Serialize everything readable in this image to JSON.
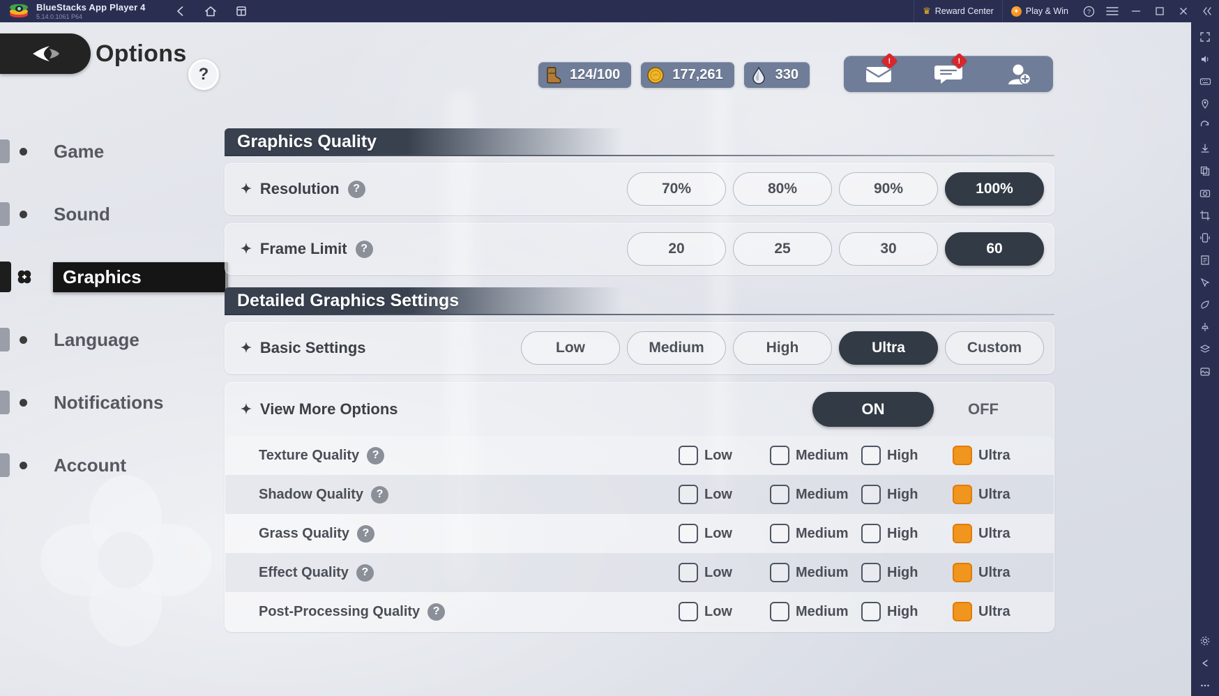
{
  "window": {
    "app_name": "BlueStacks App Player 4",
    "version": "5.14.0.1061  P64",
    "logo_icon": "bluestacks-logo-icon",
    "nav": [
      {
        "name": "back",
        "icon": "arrow-left-icon"
      },
      {
        "name": "home",
        "icon": "home-icon"
      },
      {
        "name": "instances",
        "icon": "multi-instance-icon"
      }
    ],
    "right_items": [
      {
        "label": "Reward Center",
        "icon": "crown-icon"
      },
      {
        "label": "Play & Win",
        "icon": "star-badge-icon"
      }
    ],
    "controls": [
      {
        "name": "help",
        "icon": "help-circle-icon"
      },
      {
        "name": "menu",
        "icon": "hamburger-icon"
      },
      {
        "name": "minimize",
        "icon": "minimize-icon"
      },
      {
        "name": "maximize",
        "icon": "maximize-icon"
      },
      {
        "name": "close",
        "icon": "close-icon"
      },
      {
        "name": "collapse-sidebar",
        "icon": "double-chevron-left-icon"
      }
    ]
  },
  "rail": {
    "items": [
      "fullscreen-icon",
      "volume-icon",
      "keyboard-icon",
      "location-icon",
      "rotate-icon",
      "install-apk-icon",
      "copy-icon",
      "screenshot-icon",
      "crop-screenshot-icon",
      "shake-icon",
      "script-icon",
      "macro-icon",
      "eco-mode-icon",
      "pin-icon",
      "layers-icon",
      "media-manager-icon"
    ],
    "bottom_items": [
      "settings-gear-icon",
      "back-arrow-icon",
      "more-dots-icon"
    ]
  },
  "game": {
    "header": {
      "back_icon": "back-chevron-icon",
      "title": "Options",
      "help_label": "?"
    },
    "currencies": [
      {
        "icon": "boot-icon",
        "value": "124/100"
      },
      {
        "icon": "coin-icon",
        "value": "177,261"
      },
      {
        "icon": "water-drop-icon",
        "value": "330"
      }
    ],
    "social": [
      {
        "icon": "mail-icon",
        "badge": "!"
      },
      {
        "icon": "chat-icon",
        "badge": "!"
      },
      {
        "icon": "add-friend-icon",
        "badge": ""
      }
    ],
    "sidebar": {
      "items": [
        {
          "label": "Game",
          "icon": "bullet-dot-icon",
          "active": false
        },
        {
          "label": "Sound",
          "icon": "bullet-dot-icon",
          "active": false
        },
        {
          "label": "Graphics",
          "icon": "clover-icon",
          "active": true
        },
        {
          "label": "Language",
          "icon": "bullet-dot-icon",
          "active": false
        },
        {
          "label": "Notifications",
          "icon": "bullet-dot-icon",
          "active": false
        },
        {
          "label": "Account",
          "icon": "bullet-dot-icon",
          "active": false
        }
      ]
    },
    "sections": {
      "graphics_quality": {
        "title": "Graphics Quality",
        "rows": [
          {
            "label": "Resolution",
            "help": "?",
            "options": [
              "70%",
              "80%",
              "90%",
              "100%"
            ],
            "selected": "100%"
          },
          {
            "label": "Frame Limit",
            "help": "?",
            "options": [
              "20",
              "25",
              "30",
              "60"
            ],
            "selected": "60"
          }
        ]
      },
      "detailed_graphics": {
        "title": "Detailed Graphics Settings",
        "basic": {
          "label": "Basic Settings",
          "options": [
            "Low",
            "Medium",
            "High",
            "Ultra",
            "Custom"
          ],
          "selected": "Ultra"
        },
        "view_more": {
          "label": "View More Options",
          "on_label": "ON",
          "off_label": "OFF",
          "selected": "ON"
        },
        "quality_options": [
          "Low",
          "Medium",
          "High",
          "Ultra"
        ],
        "quality_rows": [
          {
            "label": "Texture Quality",
            "help": "?",
            "selected": "Ultra"
          },
          {
            "label": "Shadow Quality",
            "help": "?",
            "selected": "Ultra"
          },
          {
            "label": "Grass Quality",
            "help": "?",
            "selected": "Ultra"
          },
          {
            "label": "Effect Quality",
            "help": "?",
            "selected": "Ultra"
          },
          {
            "label": "Post-Processing Quality",
            "help": "?",
            "selected": "Ultra"
          }
        ]
      }
    }
  },
  "colors": {
    "titlebar": "#2a2f52",
    "accent_orange": "#f0951e",
    "selected_dark": "#323a45",
    "currency_pill": "#6f7d98",
    "badge_red": "#d9262b"
  }
}
